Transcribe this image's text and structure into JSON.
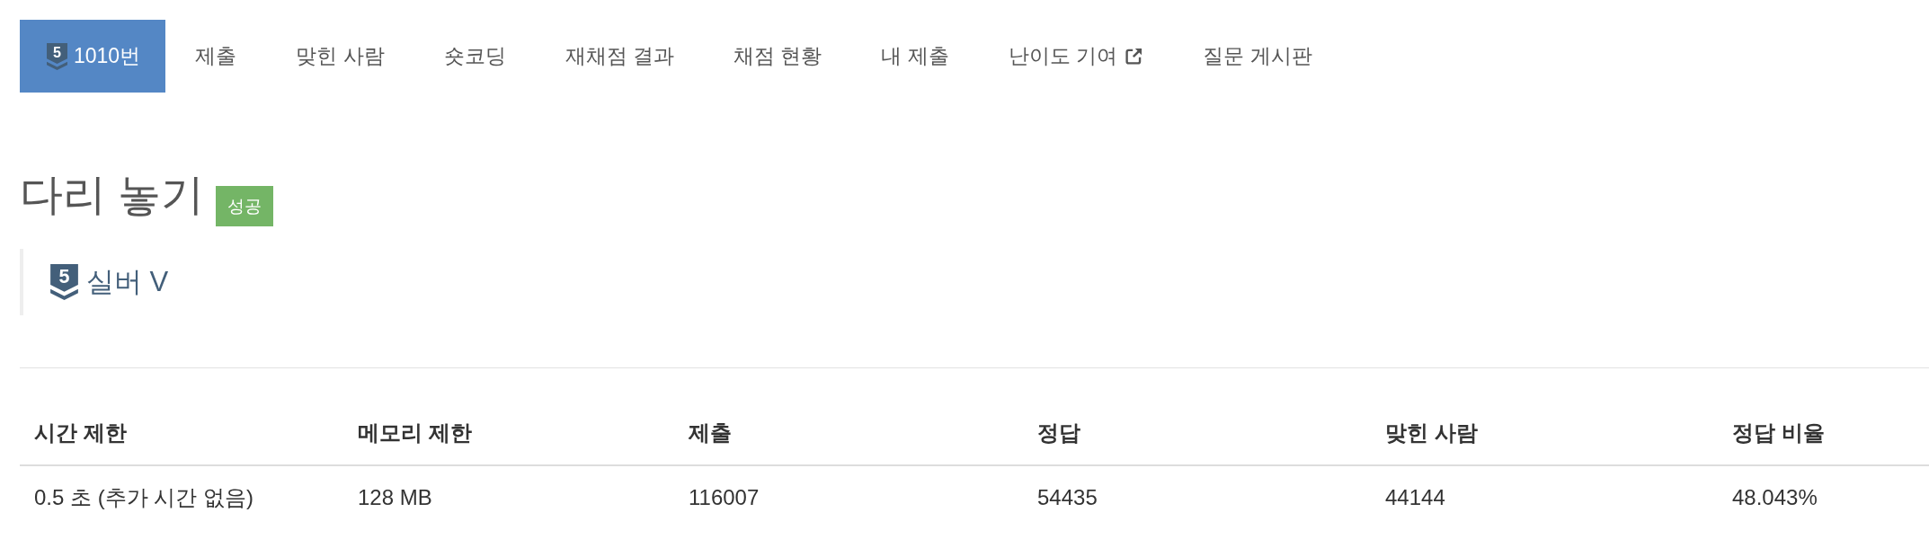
{
  "nav": {
    "tabs": [
      {
        "label": "1010번",
        "badge": "5",
        "selected": true,
        "external": false
      },
      {
        "label": "제출",
        "selected": false,
        "external": false
      },
      {
        "label": "맞힌 사람",
        "selected": false,
        "external": false
      },
      {
        "label": "숏코딩",
        "selected": false,
        "external": false
      },
      {
        "label": "재채점 결과",
        "selected": false,
        "external": false
      },
      {
        "label": "채점 현황",
        "selected": false,
        "external": false
      },
      {
        "label": "내 제출",
        "selected": false,
        "external": false
      },
      {
        "label": "난이도 기여",
        "selected": false,
        "external": true
      },
      {
        "label": "질문 게시판",
        "selected": false,
        "external": false
      }
    ]
  },
  "problem": {
    "title": "다리 놓기",
    "status": {
      "text": "성공",
      "kind": "success"
    },
    "tier": {
      "number": "5",
      "label": "실버 V"
    }
  },
  "info_table": {
    "columns": [
      "시간 제한",
      "메모리 제한",
      "제출",
      "정답",
      "맞힌 사람",
      "정답 비율"
    ],
    "rows": [
      [
        "0.5 초 (추가 시간 없음)",
        "128 MB",
        "116007",
        "54435",
        "44144",
        "48.043%"
      ]
    ]
  }
}
